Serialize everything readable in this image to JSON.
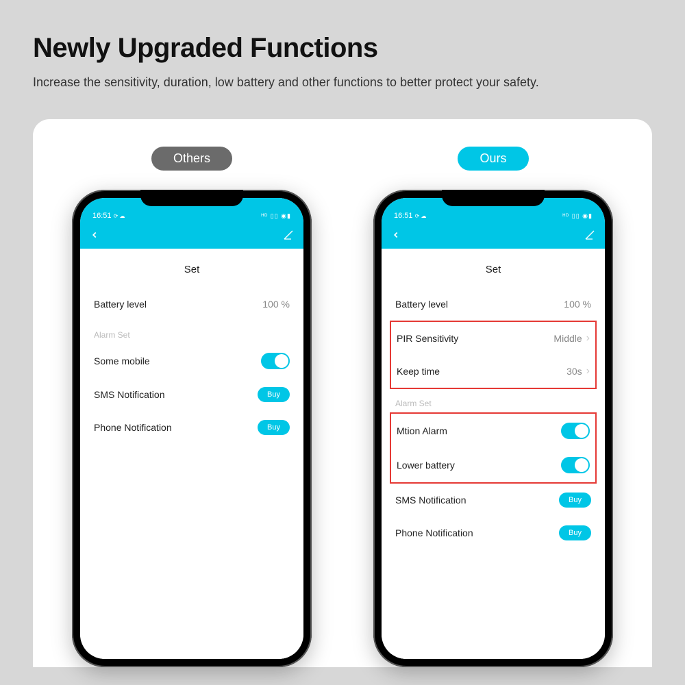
{
  "header": {
    "title": "Newly Upgraded Functions",
    "subtitle": "Increase the sensitivity, duration, low battery and other functions to better protect your safety."
  },
  "pills": {
    "others": "Others",
    "ours": "Ours"
  },
  "status": {
    "time": "16:51",
    "indicators": "⟳ ☁",
    "right": "ᴴᴰ ▯▯ ◉▮"
  },
  "app": {
    "page_title": "Set"
  },
  "others": {
    "battery_label": "Battery level",
    "battery_value": "100 %",
    "alarm_section": "Alarm Set",
    "some_mobile": "Some mobile",
    "sms": "SMS Notification",
    "phone": "Phone Notification",
    "buy": "Buy"
  },
  "ours": {
    "battery_label": "Battery level",
    "battery_value": "100 %",
    "pir_label": "PIR Sensitivity",
    "pir_value": "Middle",
    "keep_label": "Keep time",
    "keep_value": "30s",
    "alarm_section": "Alarm Set",
    "motion": "Mtion Alarm",
    "lowbat": "Lower battery",
    "sms": "SMS Notification",
    "phone": "Phone Notification",
    "buy": "Buy"
  }
}
